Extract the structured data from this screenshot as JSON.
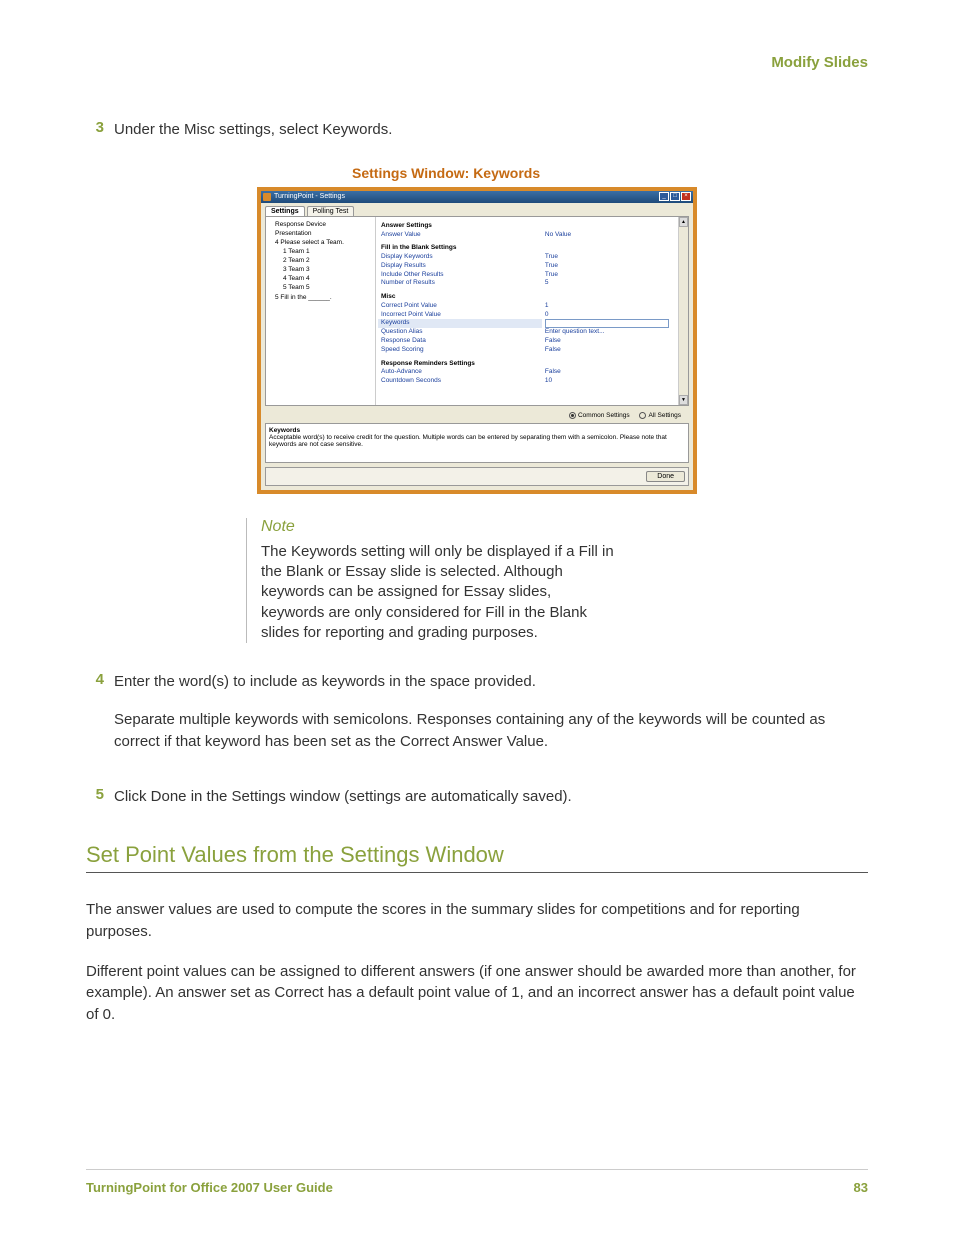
{
  "header": {
    "section": "Modify Slides"
  },
  "steps": {
    "s3": {
      "num": "3",
      "text": "Under the Misc settings, select Keywords."
    },
    "s4": {
      "num": "4",
      "text": "Enter the word(s) to include as keywords in the space provided.",
      "para2": "Separate multiple keywords with semicolons. Responses containing any of the keywords will be counted as correct if that keyword has been set as the Correct Answer Value."
    },
    "s5": {
      "num": "5",
      "text": "Click Done in the Settings window (settings are automatically saved)."
    }
  },
  "figure": {
    "caption": "Settings Window: Keywords"
  },
  "screenshot": {
    "title": "TurningPoint - Settings",
    "tabs": {
      "t1": "Settings",
      "t2": "Polling Test"
    },
    "tree": {
      "n0": "Response Device",
      "n1": "Presentation",
      "n2": "4  Please select a Team.",
      "n2a": "1  Team 1",
      "n2b": "2  Team 2",
      "n2c": "3  Team 3",
      "n2d": "4  Team 4",
      "n2e": "5  Team 5",
      "n3": "5  Fill in the ______."
    },
    "grid": {
      "answer_hdr": "Answer Settings",
      "answer_value_k": "Answer Value",
      "answer_value_v": "No Value",
      "fib_hdr": "Fill in the Blank Settings",
      "disp_kw_k": "Display Keywords",
      "disp_kw_v": "True",
      "disp_res_k": "Display Results",
      "disp_res_v": "True",
      "incl_other_k": "Include Other Results",
      "incl_other_v": "True",
      "num_res_k": "Number of Results",
      "num_res_v": "5",
      "misc_hdr": "Misc",
      "cpt_k": "Correct Point Value",
      "cpt_v": "1",
      "ipt_k": "Incorrect Point Value",
      "ipt_v": "0",
      "kw_k": "Keywords",
      "qa_k": "Question Alias",
      "qa_v": "Enter question text...",
      "rd_k": "Response Data",
      "rd_v": "False",
      "ss_k": "Speed Scoring",
      "ss_v": "False",
      "rr_hdr": "Response Reminders Settings",
      "aa_k": "Auto-Advance",
      "aa_v": "False",
      "cs_k": "Countdown Seconds",
      "cs_v": "10"
    },
    "radios": {
      "common": "Common Settings",
      "all": "All Settings"
    },
    "desc": {
      "title": "Keywords",
      "body": "Acceptable word(s) to receive credit for the question. Multiple words can be entered by separating them with a semicolon. Please note that keywords are not case sensitive."
    },
    "done": "Done"
  },
  "note": {
    "title": "Note",
    "body": "The Keywords setting will only be displayed if a Fill in the Blank or Essay slide is selected. Although keywords can be assigned for Essay slides, keywords are only considered for Fill in the Blank slides for reporting and grading purposes."
  },
  "section": {
    "title": "Set Point Values from the Settings Window",
    "p1": "The answer values are used to compute the scores in the summary slides for competitions and for reporting purposes.",
    "p2": "Different point values can be assigned to different answers (if one answer should be awarded more than another, for example). An answer set as Correct has a default point value of 1, and an incorrect answer has a default point value of 0."
  },
  "footer": {
    "left": "TurningPoint for Office 2007 User Guide",
    "right": "83"
  }
}
